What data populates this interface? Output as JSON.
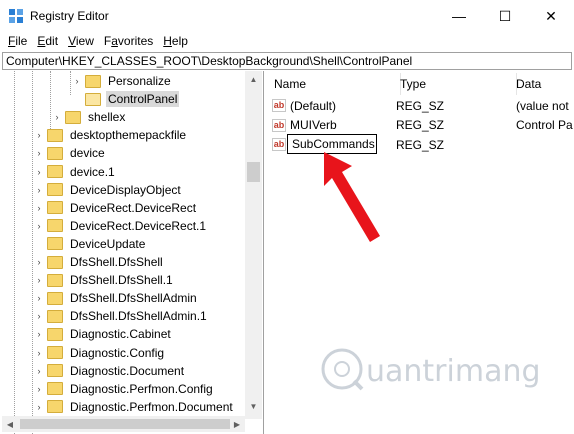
{
  "window": {
    "title": "Registry Editor",
    "min_glyph": "—",
    "max_glyph": "☐",
    "close_glyph": "✕"
  },
  "menu": [
    {
      "prefix": "",
      "ul": "F",
      "rest": "ile"
    },
    {
      "prefix": "",
      "ul": "E",
      "rest": "dit"
    },
    {
      "prefix": "",
      "ul": "V",
      "rest": "iew"
    },
    {
      "prefix": "F",
      "ul": "a",
      "rest": "vorites"
    },
    {
      "prefix": "",
      "ul": "H",
      "rest": "elp"
    }
  ],
  "address": "Computer\\HKEY_CLASSES_ROOT\\DesktopBackground\\Shell\\ControlPanel",
  "tree": [
    {
      "label": "Personalize",
      "expander": "›",
      "level": 3,
      "selected": false
    },
    {
      "label": "ControlPanel",
      "expander": "",
      "level": 3,
      "selected": true
    },
    {
      "label": "shellex",
      "expander": "›",
      "level": 2,
      "selected": false
    },
    {
      "label": "desktopthemepackfile",
      "expander": "›",
      "level": 1,
      "selected": false
    },
    {
      "label": "device",
      "expander": "›",
      "level": 1,
      "selected": false
    },
    {
      "label": "device.1",
      "expander": "›",
      "level": 1,
      "selected": false
    },
    {
      "label": "DeviceDisplayObject",
      "expander": "›",
      "level": 1,
      "selected": false
    },
    {
      "label": "DeviceRect.DeviceRect",
      "expander": "›",
      "level": 1,
      "selected": false
    },
    {
      "label": "DeviceRect.DeviceRect.1",
      "expander": "›",
      "level": 1,
      "selected": false
    },
    {
      "label": "DeviceUpdate",
      "expander": "",
      "level": 1,
      "selected": false
    },
    {
      "label": "DfsShell.DfsShell",
      "expander": "›",
      "level": 1,
      "selected": false
    },
    {
      "label": "DfsShell.DfsShell.1",
      "expander": "›",
      "level": 1,
      "selected": false
    },
    {
      "label": "DfsShell.DfsShellAdmin",
      "expander": "›",
      "level": 1,
      "selected": false
    },
    {
      "label": "DfsShell.DfsShellAdmin.1",
      "expander": "›",
      "level": 1,
      "selected": false
    },
    {
      "label": "Diagnostic.Cabinet",
      "expander": "›",
      "level": 1,
      "selected": false
    },
    {
      "label": "Diagnostic.Config",
      "expander": "›",
      "level": 1,
      "selected": false
    },
    {
      "label": "Diagnostic.Document",
      "expander": "›",
      "level": 1,
      "selected": false
    },
    {
      "label": "Diagnostic.Perfmon.Config",
      "expander": "›",
      "level": 1,
      "selected": false
    },
    {
      "label": "Diagnostic.Perfmon.Document",
      "expander": "›",
      "level": 1,
      "selected": false
    }
  ],
  "columns": {
    "name": "Name",
    "type": "Type",
    "data": "Data"
  },
  "values": [
    {
      "icon": "ab",
      "name": "(Default)",
      "type": "REG_SZ",
      "data": "(value not"
    },
    {
      "icon": "ab",
      "name": "MUIVerb",
      "type": "REG_SZ",
      "data": "Control Pa"
    },
    {
      "icon": "ab",
      "name": "",
      "type": "REG_SZ",
      "data": ""
    }
  ],
  "rename_value": "SubCommands",
  "watermark": "uantrimang",
  "colors": {
    "arrow": "#e8141b",
    "selection": "#d9d9d9",
    "folder": "#f7d66c"
  }
}
